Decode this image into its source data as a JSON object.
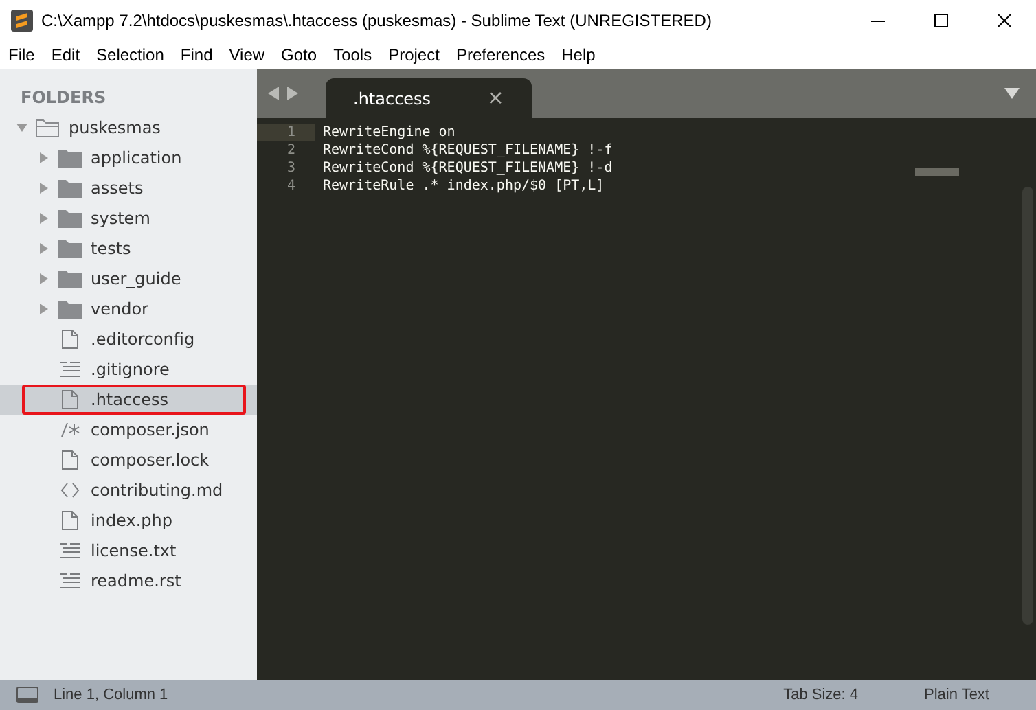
{
  "window": {
    "title": "C:\\Xampp 7.2\\htdocs\\puskesmas\\.htaccess (puskesmas) - Sublime Text (UNREGISTERED)"
  },
  "menu": [
    "File",
    "Edit",
    "Selection",
    "Find",
    "View",
    "Goto",
    "Tools",
    "Project",
    "Preferences",
    "Help"
  ],
  "sidebar": {
    "heading": "FOLDERS",
    "tree": [
      {
        "name": "puskesmas",
        "kind": "folder",
        "expanded": true,
        "selected": false,
        "children": [
          {
            "name": "application",
            "kind": "folder",
            "expanded": false,
            "selected": false
          },
          {
            "name": "assets",
            "kind": "folder",
            "expanded": false,
            "selected": false
          },
          {
            "name": "system",
            "kind": "folder",
            "expanded": false,
            "selected": false
          },
          {
            "name": "tests",
            "kind": "folder",
            "expanded": false,
            "selected": false
          },
          {
            "name": "user_guide",
            "kind": "folder",
            "expanded": false,
            "selected": false
          },
          {
            "name": "vendor",
            "kind": "folder",
            "expanded": false,
            "selected": false
          },
          {
            "name": ".editorconfig",
            "kind": "file",
            "selected": false
          },
          {
            "name": ".gitignore",
            "kind": "text",
            "selected": false
          },
          {
            "name": ".htaccess",
            "kind": "file",
            "selected": true,
            "annotated": true
          },
          {
            "name": "composer.json",
            "kind": "comment",
            "selected": false
          },
          {
            "name": "composer.lock",
            "kind": "file",
            "selected": false
          },
          {
            "name": "contributing.md",
            "kind": "code",
            "selected": false
          },
          {
            "name": "index.php",
            "kind": "file",
            "selected": false
          },
          {
            "name": "license.txt",
            "kind": "text",
            "selected": false
          },
          {
            "name": "readme.rst",
            "kind": "text",
            "selected": false
          }
        ]
      }
    ]
  },
  "tabs": [
    {
      "label": ".htaccess",
      "close": "×",
      "selected": true
    }
  ],
  "editor": {
    "lines": [
      {
        "number": "1",
        "text": "RewriteEngine on",
        "current": true
      },
      {
        "number": "2",
        "text": "RewriteCond %{REQUEST_FILENAME} !-f",
        "current": false
      },
      {
        "number": "3",
        "text": "RewriteCond %{REQUEST_FILENAME} !-d",
        "current": false
      },
      {
        "number": "4",
        "text": "RewriteRule .* index.php/$0 [PT,L]",
        "current": false
      }
    ]
  },
  "status_bar": {
    "position": "Line 1, Column 1",
    "tab_size": "Tab Size: 4",
    "syntax": "Plain Text"
  }
}
